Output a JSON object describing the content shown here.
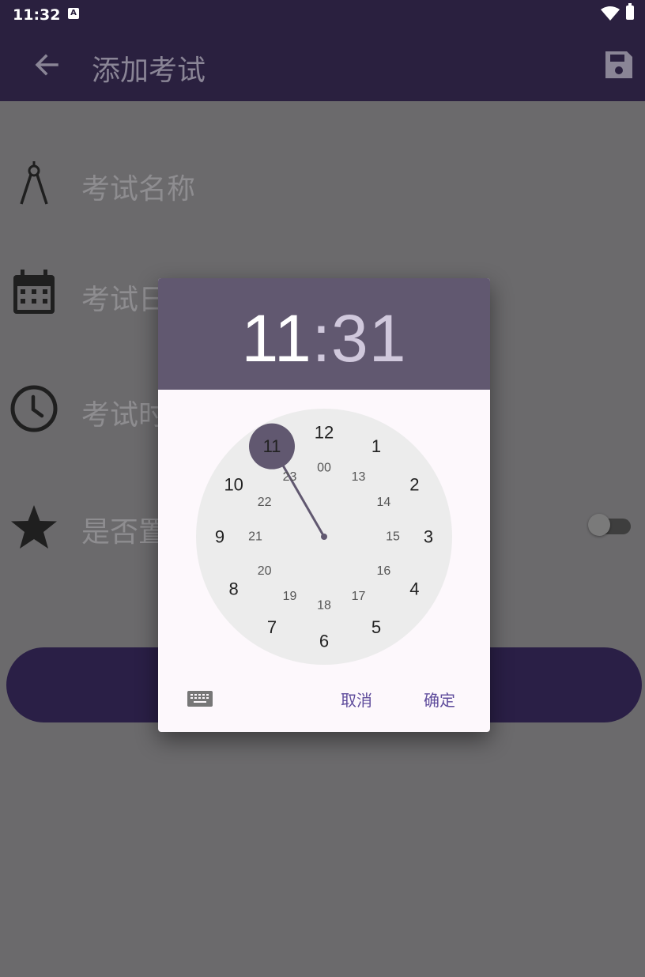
{
  "status_bar": {
    "time": "11:32",
    "notification_badge": "A"
  },
  "app_bar": {
    "title": "添加考试",
    "back_icon": "arrow-left-icon",
    "save_icon": "floppy-disk-icon"
  },
  "form": {
    "rows": [
      {
        "label": "考试名称",
        "icon": "compass-icon"
      },
      {
        "label": "考试日",
        "icon": "calendar-icon"
      },
      {
        "label": "考试时",
        "icon": "clock-icon"
      },
      {
        "label": "是否置",
        "icon": "star-icon"
      }
    ],
    "pin_toggle_on": false
  },
  "time_picker": {
    "hour": "11",
    "separator": ":",
    "minute": "31",
    "selected_hour": "11",
    "outer_numbers": [
      "12",
      "1",
      "2",
      "3",
      "4",
      "5",
      "6",
      "7",
      "8",
      "9",
      "10",
      "11"
    ],
    "inner_numbers": [
      "00",
      "13",
      "14",
      "15",
      "16",
      "17",
      "18",
      "19",
      "20",
      "21",
      "22",
      "23"
    ],
    "cancel_label": "取消",
    "ok_label": "确定",
    "keyboard_icon": "keyboard-icon",
    "colors": {
      "header": "#615870",
      "accent": "#5f4c9c",
      "selector": "#615870"
    }
  }
}
